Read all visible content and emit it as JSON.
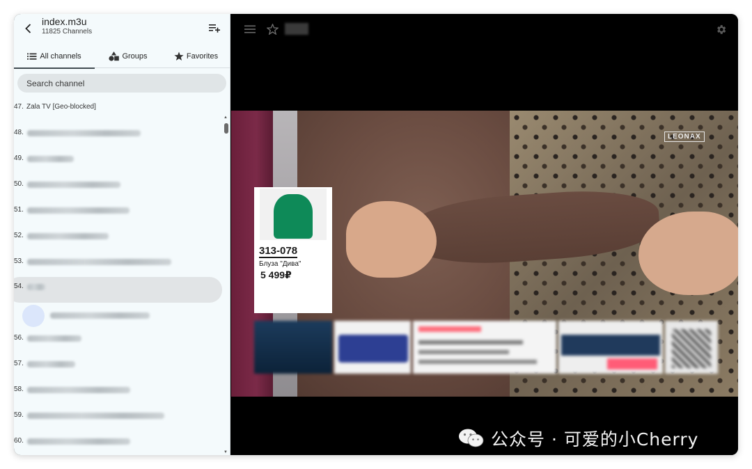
{
  "sidebar": {
    "playlist_title": "index.m3u",
    "channel_count": "11825 Channels",
    "tabs": [
      {
        "label": "All channels",
        "icon": "list-icon",
        "active": true
      },
      {
        "label": "Groups",
        "icon": "shapes-icon",
        "active": false
      },
      {
        "label": "Favorites",
        "icon": "star-icon",
        "active": false
      }
    ],
    "search_placeholder": "Search channel",
    "channels": [
      {
        "num": "47.",
        "name": "Zala TV [Geo-blocked]"
      },
      {
        "num": "48.",
        "name": ""
      },
      {
        "num": "49.",
        "name": ""
      },
      {
        "num": "50.",
        "name": ""
      },
      {
        "num": "51.",
        "name": ""
      },
      {
        "num": "52.",
        "name": ""
      },
      {
        "num": "53.",
        "name": ""
      },
      {
        "num": "54.",
        "name": "",
        "selected": true
      },
      {
        "num": "56.",
        "name": ""
      },
      {
        "num": "57.",
        "name": ""
      },
      {
        "num": "58.",
        "name": ""
      },
      {
        "num": "59.",
        "name": ""
      },
      {
        "num": "60.",
        "name": ""
      }
    ]
  },
  "player": {
    "logo_text": "LEONAX",
    "product": {
      "code": "313-078",
      "name": "Блуза \"Дива\"",
      "price": "5 499₽"
    }
  },
  "watermark": {
    "text": "公众号 · 可爱的小Cherry"
  },
  "colors": {
    "sidebar_bg": "#f4fafc",
    "selected_row": "#e1e4e6",
    "player_bg": "#000000",
    "product_green": "#0e8a58"
  }
}
